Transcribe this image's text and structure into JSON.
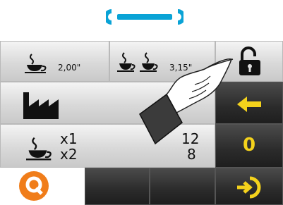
{
  "header": {
    "icon": "wrench-icon",
    "accent": "#0aa3d6"
  },
  "row1": {
    "single_espresso": {
      "icon": "coffee-cup-icon",
      "value": "2,00\""
    },
    "double_espresso": {
      "icon": "double-coffee-cup-icon",
      "value": "3,15\""
    },
    "lock": {
      "icon": "padlock-open-icon"
    }
  },
  "row2": {
    "factory": {
      "icon": "factory-icon"
    },
    "back": {
      "icon": "arrow-left-icon"
    }
  },
  "row3": {
    "counters": {
      "icon": "coffee-cup-icon",
      "label_1": "x1",
      "label_2": "x2",
      "value_1": "12",
      "value_2": "8"
    },
    "reset": {
      "label": "0",
      "color": "#f4d21c"
    }
  },
  "row4": {
    "logo": {
      "icon": "q-logo-icon",
      "color": "#f07d1a"
    },
    "exit": {
      "icon": "exit-icon"
    }
  },
  "overlay": {
    "icon": "pointing-hand-icon"
  }
}
